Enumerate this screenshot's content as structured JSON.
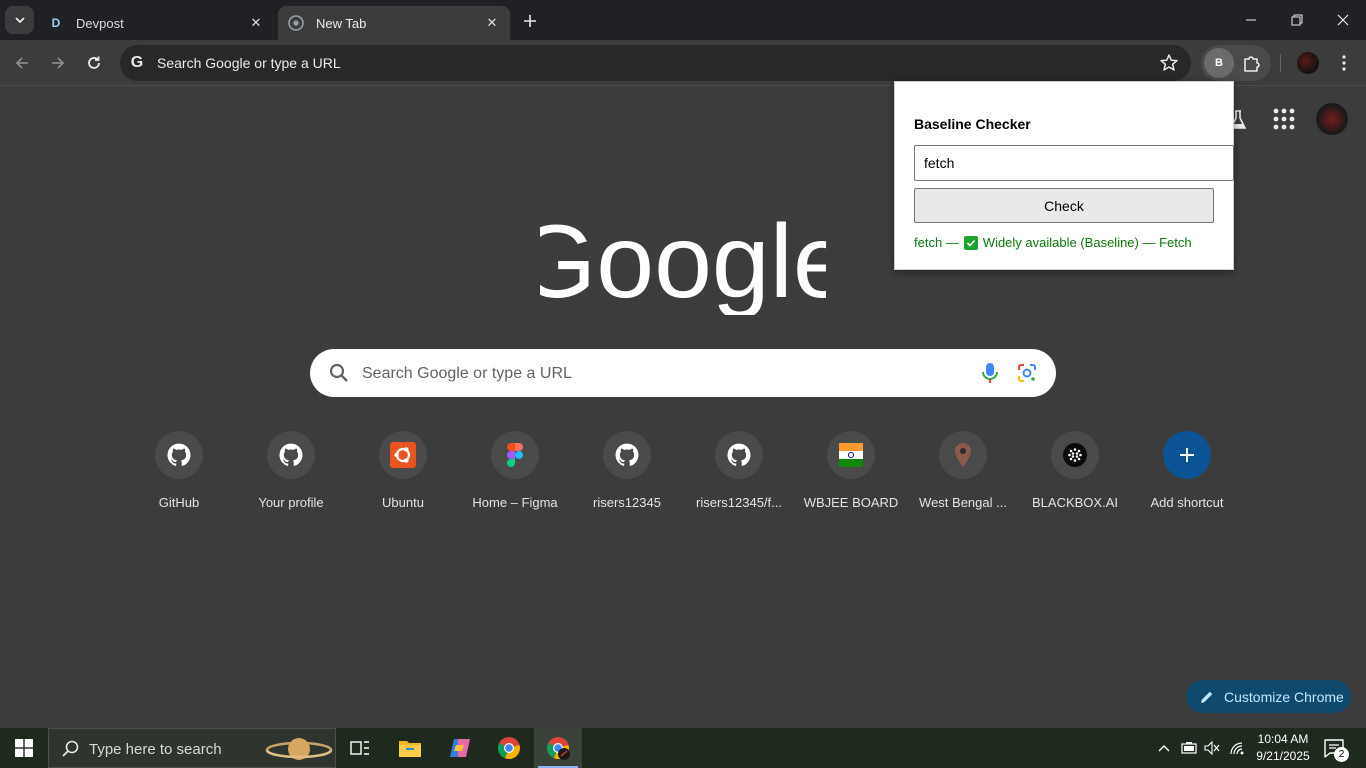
{
  "browser": {
    "tabs": [
      {
        "favicon": "devpost-icon",
        "favicon_text": "D",
        "title": "Devpost",
        "active": false
      },
      {
        "favicon": "chrome-icon",
        "title": "New Tab",
        "active": true
      }
    ],
    "omnibox": {
      "placeholder": "Search Google or type a URL"
    },
    "extension_badge": "B"
  },
  "ntp": {
    "search_placeholder": "Search Google or type a URL",
    "shortcuts": [
      {
        "label": "GitHub",
        "icon": "github-icon"
      },
      {
        "label": "Your profile",
        "icon": "github-icon"
      },
      {
        "label": "Ubuntu",
        "icon": "ubuntu-icon"
      },
      {
        "label": "Home – Figma",
        "icon": "figma-icon"
      },
      {
        "label": "risers12345",
        "icon": "github-icon"
      },
      {
        "label": "risers12345/f...",
        "icon": "github-icon"
      },
      {
        "label": "WBJEE BOARD",
        "icon": "india-flag-icon"
      },
      {
        "label": "West Bengal ...",
        "icon": "map-pin-icon"
      },
      {
        "label": "BLACKBOX.AI",
        "icon": "blackbox-icon"
      },
      {
        "label": "Add shortcut",
        "icon": "plus-icon"
      }
    ],
    "customize_label": "Customize Chrome"
  },
  "popup": {
    "title": "Baseline Checker",
    "input_value": "fetch",
    "button_label": "Check",
    "result_prefix": "fetch —",
    "result_text": "Widely available (Baseline) — Fetch"
  },
  "taskbar": {
    "search_placeholder": "Type here to search",
    "time": "10:04 AM",
    "date": "9/21/2025",
    "notification_count": "2"
  },
  "colors": {
    "page_bg": "#3c3c3c",
    "tab_strip": "#202124",
    "accent_blue": "#0b5394",
    "result_green": "#0a7a0a"
  }
}
